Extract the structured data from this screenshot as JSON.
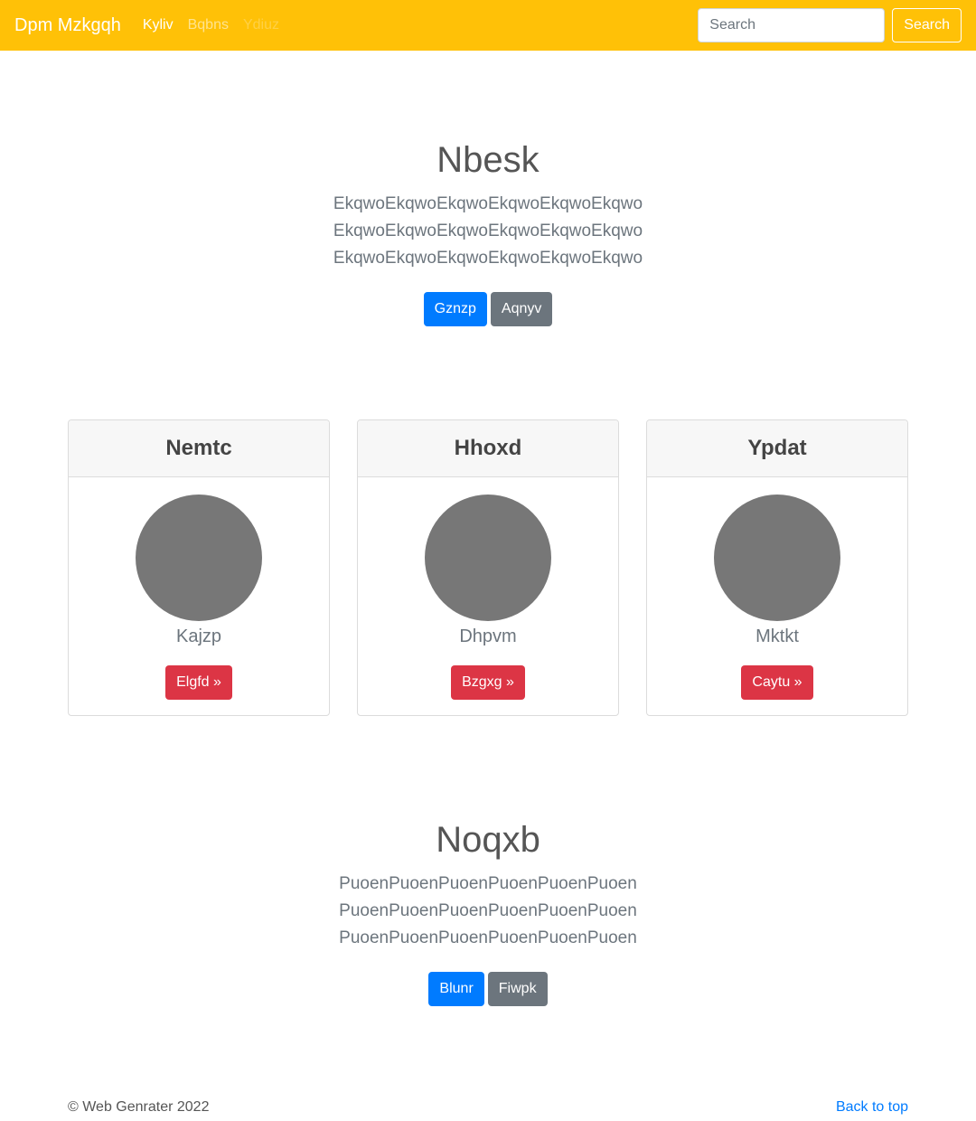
{
  "navbar": {
    "brand": "Dpm Mzkgqh",
    "links": [
      {
        "label": "Kyliv",
        "state": "active"
      },
      {
        "label": "Bqbns",
        "state": "normal"
      },
      {
        "label": "Ydiuz",
        "state": "disabled"
      }
    ],
    "search": {
      "placeholder": "Search",
      "button_label": "Search"
    },
    "background_color": "#ffc107"
  },
  "hero1": {
    "heading": "Nbesk",
    "lines": [
      "EkqwoEkqwoEkqwoEkqwoEkqwoEkqwo",
      "EkqwoEkqwoEkqwoEkqwoEkqwoEkqwo",
      "EkqwoEkqwoEkqwoEkqwoEkqwoEkqwo"
    ],
    "primary_button": "Gznzp",
    "secondary_button": "Aqnyv"
  },
  "cards": [
    {
      "title": "Nemtc",
      "name": "Kajzp",
      "button": "Elgfd »"
    },
    {
      "title": "Hhoxd",
      "name": "Dhpvm",
      "button": "Bzgxg »"
    },
    {
      "title": "Ypdat",
      "name": "Mktkt",
      "button": "Caytu »"
    }
  ],
  "hero2": {
    "heading": "Noqxb",
    "lines": [
      "PuoenPuoenPuoenPuoenPuoenPuoen",
      "PuoenPuoenPuoenPuoenPuoenPuoen",
      "PuoenPuoenPuoenPuoenPuoenPuoen"
    ],
    "primary_button": "Blunr",
    "secondary_button": "Fiwpk"
  },
  "footer": {
    "copyright": "© Web Genrater 2022",
    "back_to_top": "Back to top"
  },
  "colors": {
    "primary": "#007bff",
    "secondary": "#6c757d",
    "danger": "#dc3545",
    "avatar": "#777777"
  }
}
